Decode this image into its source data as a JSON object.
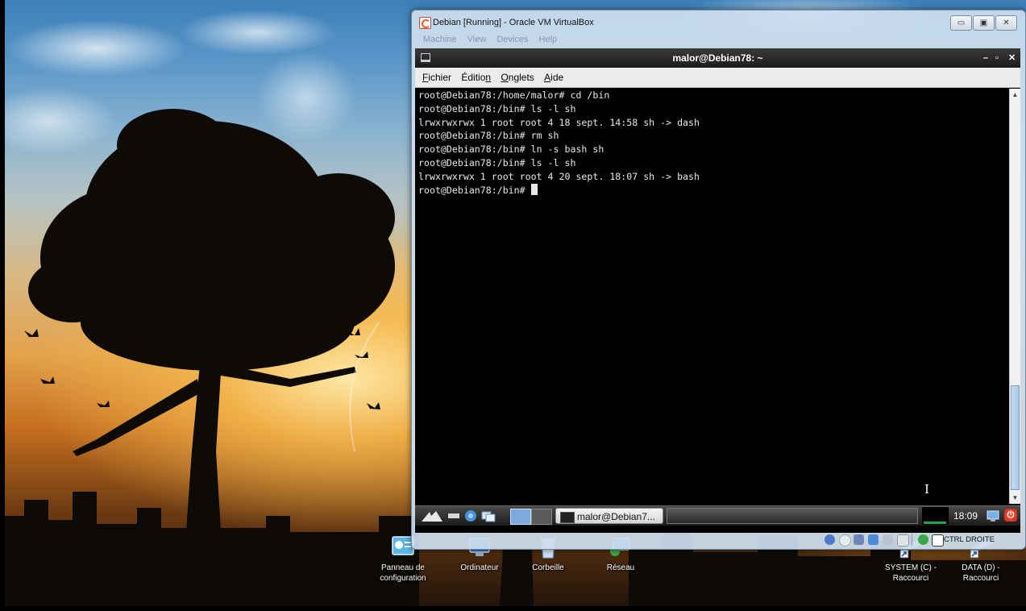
{
  "desktop": {
    "icons": [
      {
        "label": "Panneau de configuration",
        "line1": "Panneau de",
        "line2": "configuration",
        "icon": "control-panel-icon"
      },
      {
        "label": "Ordinateur",
        "icon": "computer-icon"
      },
      {
        "label": "Corbeille",
        "icon": "recycle-bin-icon"
      },
      {
        "label": "Réseau",
        "icon": "network-icon"
      },
      {
        "label": "SYSTEM (C) - Raccourci",
        "line1": "SYSTEM (C) -",
        "line2": "Raccourci",
        "icon": "drive-shortcut-icon"
      },
      {
        "label": "DATA (D) - Raccourci",
        "line1": "DATA (D) -",
        "line2": "Raccourci",
        "icon": "drive-shortcut-icon"
      }
    ]
  },
  "vbox": {
    "title": "Debian [Running] - Oracle VM VirtualBox",
    "menu": [
      "Machine",
      "View",
      "Devices",
      "Help"
    ],
    "controls": {
      "minimize": "▭",
      "restore": "▣",
      "close": "✕"
    },
    "host_key": "CTRL DROITE"
  },
  "terminal": {
    "window_title": "malor@Debian78: ~",
    "title_controls": {
      "minimize": "–",
      "maximize": "▫",
      "close": "✕"
    },
    "menu": [
      {
        "label": "Fichier",
        "accel": "F",
        "rest": "ichier"
      },
      {
        "label": "Édition",
        "pre": "Éditio",
        "accel": "n"
      },
      {
        "label": "Onglets",
        "accel": "O",
        "rest": "nglets"
      },
      {
        "label": "Aide",
        "accel": "A",
        "rest": "ide"
      }
    ],
    "lines": [
      "root@Debian78:/home/malor# cd /bin",
      "root@Debian78:/bin# ls -l sh",
      "lrwxrwxrwx 1 root root 4 18 sept. 14:58 sh -> dash",
      "root@Debian78:/bin# rm sh",
      "root@Debian78:/bin# ln -s bash sh",
      "root@Debian78:/bin# ls -l sh",
      "lrwxrwxrwx 1 root root 4 20 sept. 18:07 sh -> bash"
    ],
    "prompt": "root@Debian78:/bin# "
  },
  "guest_panel": {
    "task_label": "malor@Debian7...",
    "clock": "18:09",
    "power_glyph": "⏻"
  },
  "colors": {
    "terminal_bg": "#000000",
    "terminal_fg": "#e8e8e8",
    "vbox_frame": "#cddeee",
    "scroll_thumb": "#a9c6ea"
  }
}
